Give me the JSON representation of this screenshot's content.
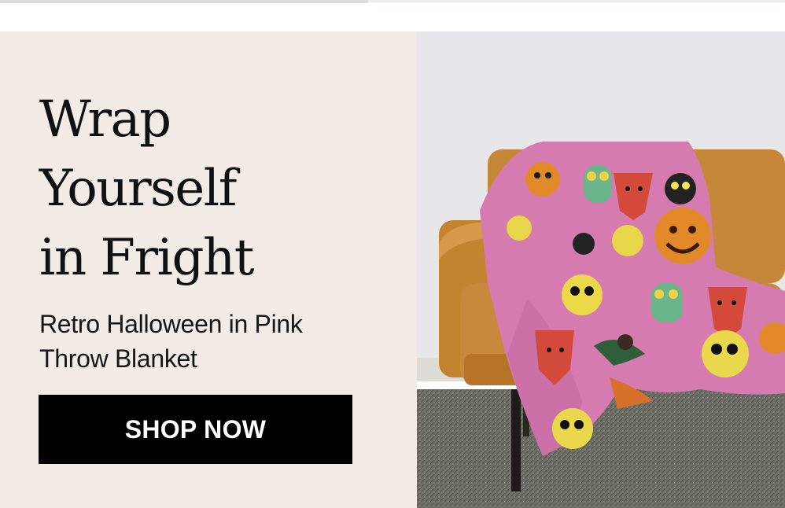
{
  "promo": {
    "headline": "Wrap\nYourself\nin Fright",
    "subtitle_line1": "Retro Halloween in Pink",
    "subtitle_line2": "Throw Blanket",
    "cta_label": "SHOP NOW"
  },
  "colors": {
    "panel_bg": "#f2ebe6",
    "button_bg": "#000000",
    "button_text": "#ffffff",
    "sofa": "#c9883b",
    "blanket_pink": "#d97fb3",
    "wall": "#e6e6e8",
    "rug": "#6f706b"
  },
  "image": {
    "subject_icon": "halloween-blanket-on-sofa-photo"
  }
}
